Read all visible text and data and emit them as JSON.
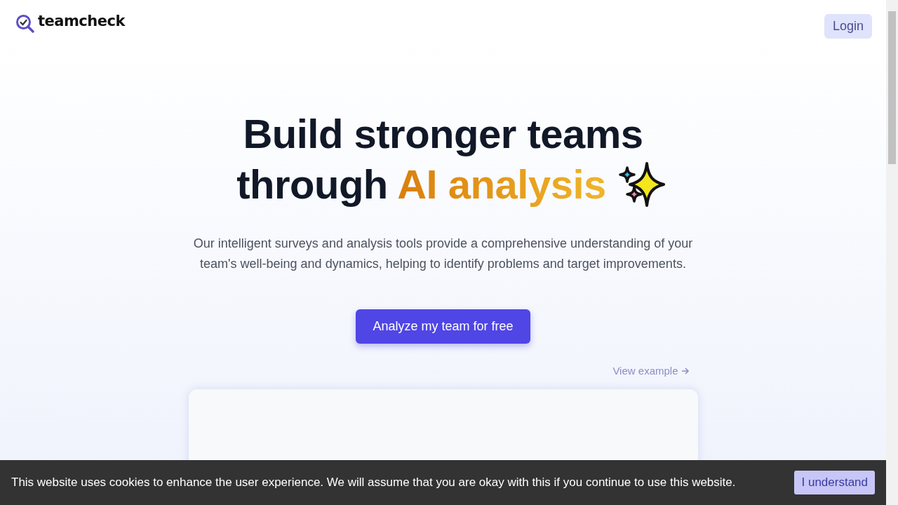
{
  "header": {
    "brand": "teamcheck",
    "login": "Login"
  },
  "hero": {
    "title_line_1": "Build stronger teams",
    "title_line_2": "through",
    "title_highlight": "AI analysis",
    "description": "Our intelligent surveys and analysis tools provide a comprehensive understanding of your team's well-being and dynamics, helping to identify problems and target improvements.",
    "cta": "Analyze my team for free",
    "example_link": "View example"
  },
  "cookie_banner": {
    "message": "This website uses cookies to enhance the user experience. We will assume that you are okay with this if you continue to use this website.",
    "button": "I understand"
  }
}
